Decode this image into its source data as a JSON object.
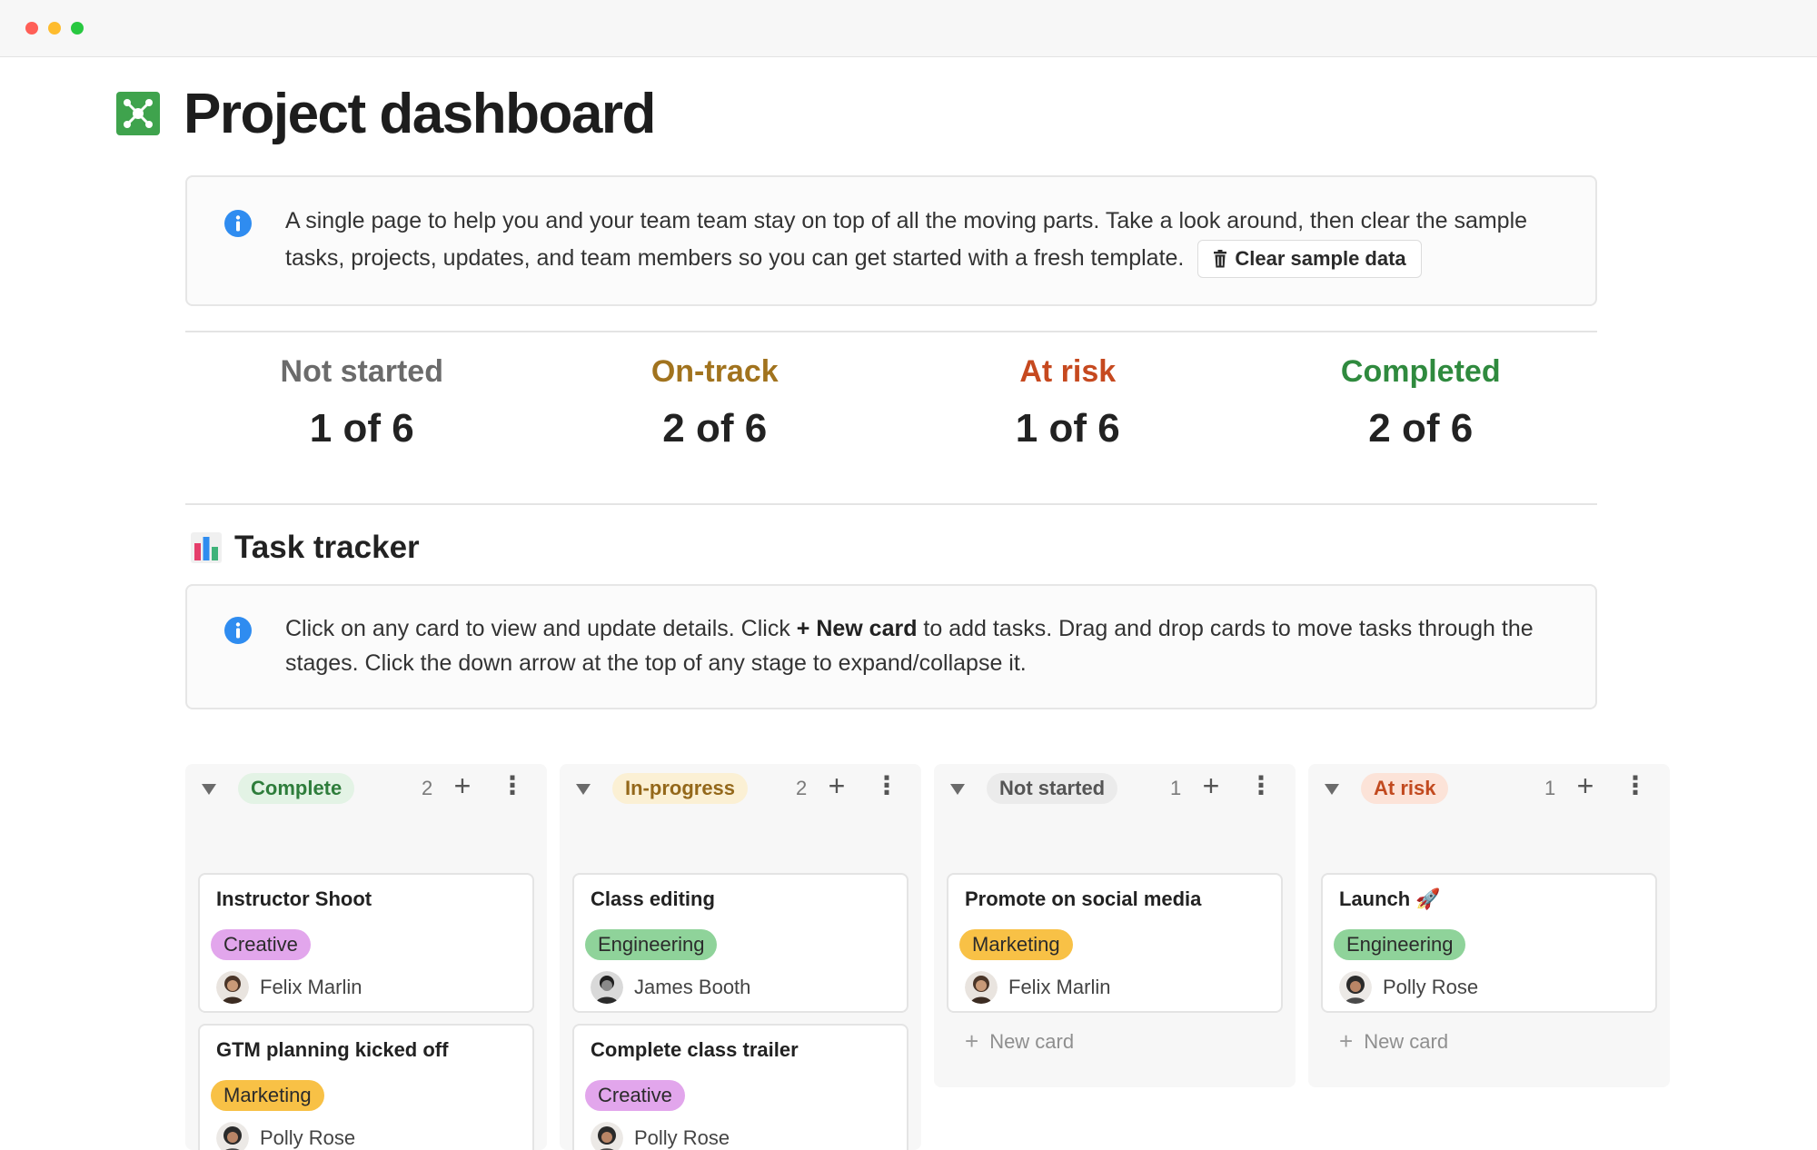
{
  "window": {
    "controls": [
      {
        "name": "close",
        "color": "#ff5f57"
      },
      {
        "name": "minimize",
        "color": "#febc2e"
      },
      {
        "name": "maximize",
        "color": "#28c840"
      }
    ]
  },
  "page": {
    "title": "Project dashboard",
    "icon": "network-icon"
  },
  "intro_callout": {
    "icon": "info-icon",
    "text": "A single page to help you and your team team stay on top of all the moving parts. Take a look around, then clear the sample tasks, projects, updates, and team members so you can get started with a fresh template.",
    "button_icon": "trash-icon",
    "button_label": "Clear sample data"
  },
  "stats": [
    {
      "label": "Not started",
      "value": "1 of 6",
      "color": "#6b6b6b"
    },
    {
      "label": "On-track",
      "value": "2 of 6",
      "color": "#a1731e"
    },
    {
      "label": "At risk",
      "value": "1 of 6",
      "color": "#c6491f"
    },
    {
      "label": "Completed",
      "value": "2 of 6",
      "color": "#2f8a3e"
    }
  ],
  "task_tracker": {
    "icon": "bar-chart-icon",
    "title": "Task tracker",
    "help_pre": "Click on any card to view and update details. Click ",
    "help_bold": "+ New card",
    "help_post": " to add tasks. Drag and drop cards to move tasks through the stages. Click the down arrow at the top of any stage to expand/collapse it."
  },
  "board": {
    "new_card_label": "New card",
    "columns": [
      {
        "status": "Complete",
        "count": "2",
        "pill_bg": "#e3f3e5",
        "pill_color": "#2e7d3b",
        "cards": [
          {
            "title": "Instructor Shoot",
            "tag": "Creative",
            "tag_color": "#e2a6ec",
            "assignee": "Felix Marlin",
            "avatar": "felix"
          },
          {
            "title": "GTM planning kicked off",
            "tag": "Marketing",
            "tag_color": "#f8c146",
            "assignee": "Polly Rose",
            "avatar": "polly"
          }
        ]
      },
      {
        "status": "In-progress",
        "count": "2",
        "pill_bg": "#fbf0d4",
        "pill_color": "#94681a",
        "cards": [
          {
            "title": "Class editing",
            "tag": "Engineering",
            "tag_color": "#8fd39a",
            "assignee": "James Booth",
            "avatar": "james"
          },
          {
            "title": "Complete class trailer",
            "tag": "Creative",
            "tag_color": "#e2a6ec",
            "assignee": "Polly Rose",
            "avatar": "polly"
          }
        ]
      },
      {
        "status": "Not started",
        "count": "1",
        "pill_bg": "#ebebeb",
        "pill_color": "#555555",
        "cards": [
          {
            "title": "Promote on social media",
            "tag": "Marketing",
            "tag_color": "#f8c146",
            "assignee": "Felix Marlin",
            "avatar": "felix"
          }
        ]
      },
      {
        "status": "At risk",
        "count": "1",
        "pill_bg": "#fce3d8",
        "pill_color": "#c24a1f",
        "cards": [
          {
            "title": "Launch 🚀",
            "tag": "Engineering",
            "tag_color": "#8fd39a",
            "assignee": "Polly Rose",
            "avatar": "polly"
          }
        ]
      }
    ]
  }
}
